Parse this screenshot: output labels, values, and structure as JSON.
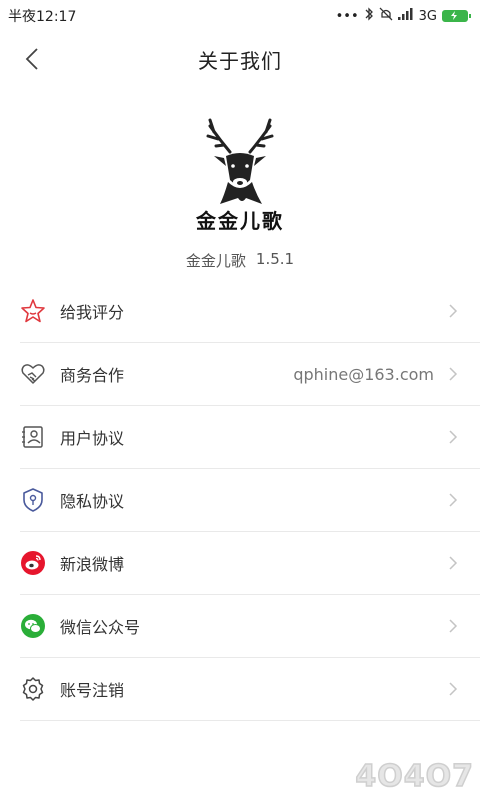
{
  "status_bar": {
    "time": "半夜12:17",
    "network": "3G"
  },
  "nav": {
    "title": "关于我们"
  },
  "app": {
    "logo_text": "金金儿歌",
    "name": "金金儿歌",
    "version": "1.5.1"
  },
  "menu": [
    {
      "label": "给我评分",
      "value": "",
      "icon": "star-icon",
      "color": "#e0383e"
    },
    {
      "label": "商务合作",
      "value": "qphine@163.com",
      "icon": "handshake-icon",
      "color": "#555555"
    },
    {
      "label": "用户协议",
      "value": "",
      "icon": "user-card-icon",
      "color": "#555555"
    },
    {
      "label": "隐私协议",
      "value": "",
      "icon": "shield-icon",
      "color": "#4a5a9c"
    },
    {
      "label": "新浪微博",
      "value": "",
      "icon": "weibo-icon",
      "color": "#e6162d"
    },
    {
      "label": "微信公众号",
      "value": "",
      "icon": "wechat-icon",
      "color": "#2aae38"
    },
    {
      "label": "账号注销",
      "value": "",
      "icon": "gear-icon",
      "color": "#444444"
    }
  ],
  "watermark": "4O4O7"
}
